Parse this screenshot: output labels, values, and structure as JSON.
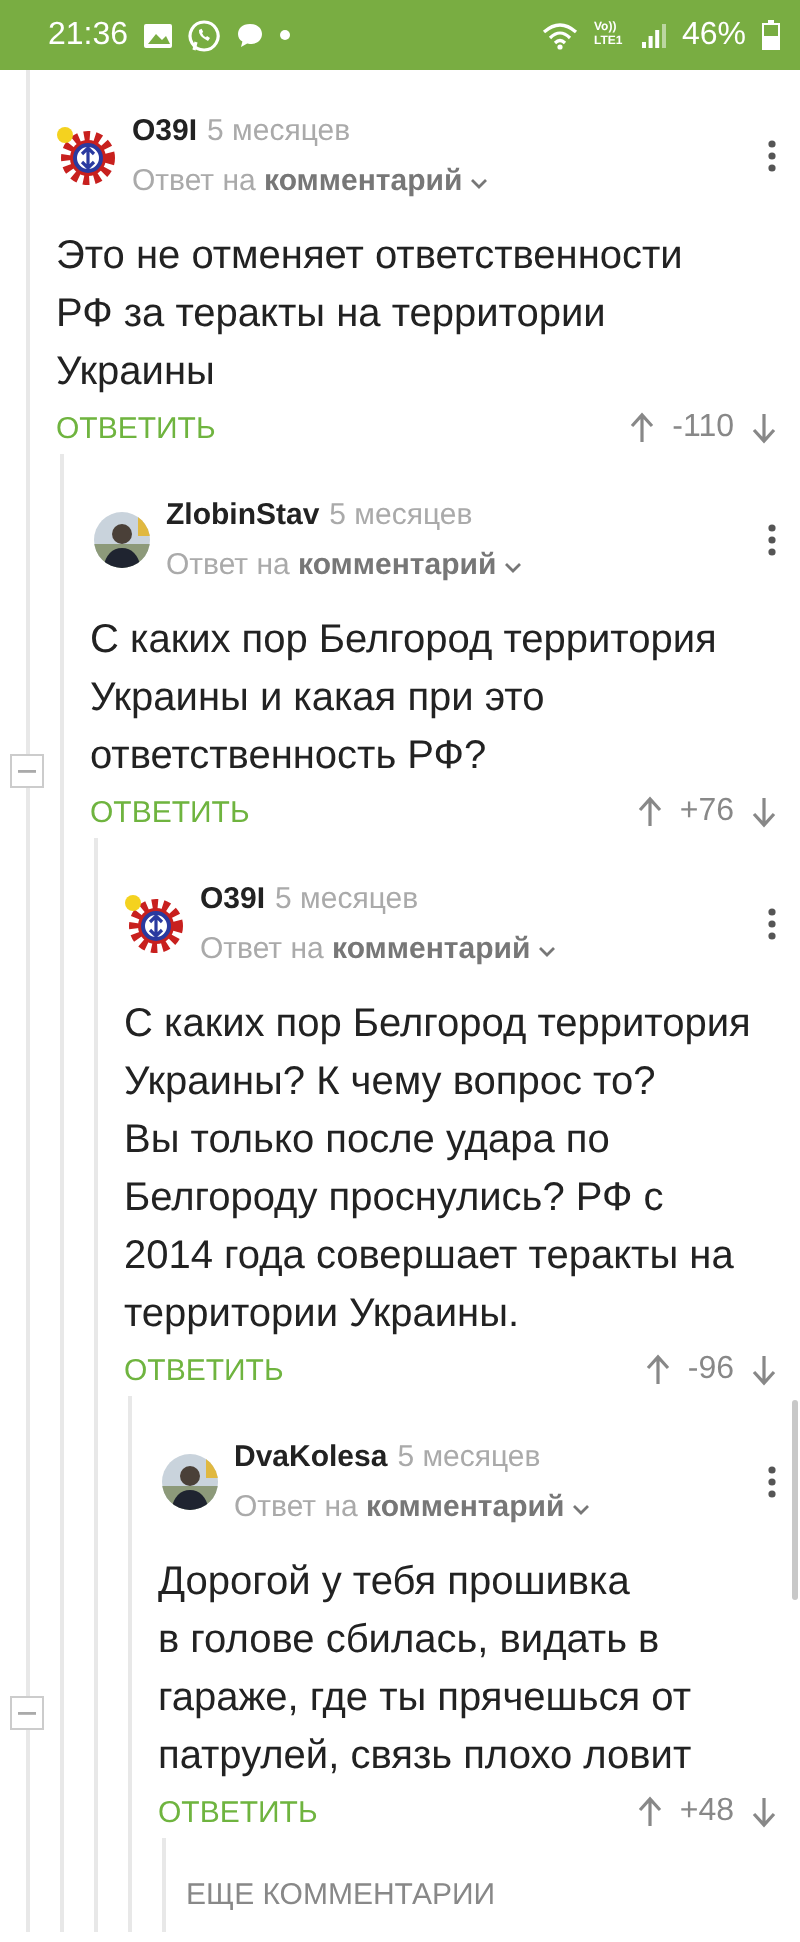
{
  "status_bar": {
    "time": "21:36",
    "network": "Vo)) LTE1",
    "battery": "46%"
  },
  "comments": [
    {
      "kind": "comment",
      "author": "O39I",
      "time": "5 месяцев",
      "reply_to": "Ответ на **комментарий**",
      "avatar": {
        "kind": "logo",
        "badge": true
      },
      "text": "Это не отменяет ответственности\nРФ за теракты на территории\nУкраины",
      "reply": "ОТВЕТИТЬ",
      "score": "-110",
      "collapse_control": false,
      "children": [
        {
          "kind": "comment",
          "author": "ZlobinStav",
          "time": "5 месяцев",
          "reply_to": "Ответ на **комментарий**",
          "text": "С каких пор Белгород территория\nУкраины и какая при это\nответственность РФ?",
          "reply": "ОТВЕТИТЬ",
          "score": "+76",
          "collapse_control": true,
          "children": [
            {
              "kind": "comment",
              "author": "O39I",
              "time": "5 месяцев",
              "reply_to": "Ответ на **комментарий**",
              "avatar": {
                "kind": "logo",
                "badge": true
              },
              "text": "С каких пор Белгород территория\nУкраины? К чему вопрос то?\nВы только после удара по\nБелгороду проснулись? РФ с\n2014 года совершает теракты на\nтерритории Украины.",
              "reply": "ОТВЕТИТЬ",
              "score": "-96",
              "collapse_control": false,
              "children": [
                {
                  "kind": "comment",
                  "author": "DvaKolesa",
                  "time": "5 месяцев",
                  "reply_to": "Ответ на **комментарий**",
                  "text": "Дорогой у тебя прошивка\nв голове сбилась, видать в\nгараже, где ты прячешься от\nпатрулей, связь плохо ловит",
                  "reply": "ОТВЕТИТЬ",
                  "score": "+48",
                  "collapse_control": true,
                  "children": [
                    {
                      "kind": "more",
                      "label": "ЕЩЕ КОММЕНТАРИИ"
                    }
                  ]
                }
              ]
            }
          ]
        }
      ]
    }
  ]
}
